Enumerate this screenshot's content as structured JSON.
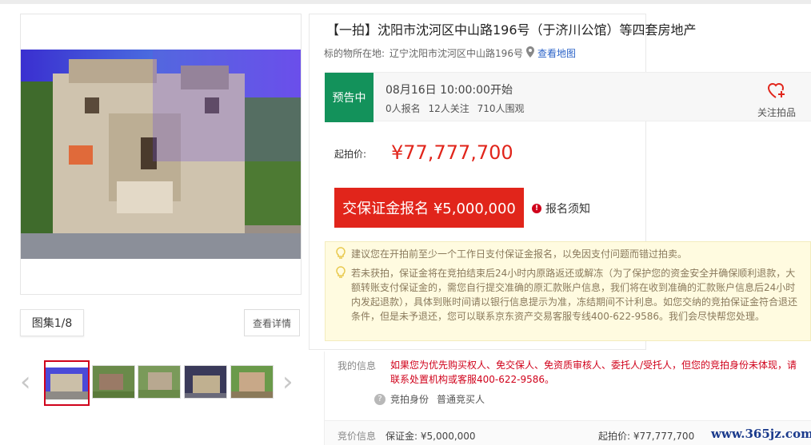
{
  "title": "【一拍】沈阳市沈河区中山路196号（于济川公馆）等四套房地产",
  "location": {
    "label": "标的物所在地:",
    "address": "辽宁沈阳市沈河区中山路196号",
    "map_link": "查看地图"
  },
  "status": {
    "badge": "预告中",
    "start_time": "08月16日 10:00:00开始",
    "signups": "0人报名",
    "followers": "12人关注",
    "viewers": "710人围观",
    "follow_label": "关注拍品"
  },
  "price": {
    "label": "起拍价:",
    "value": "¥77,777,700"
  },
  "deposit_button": "交保证金报名 ¥5,000,000",
  "notice_link": "报名须知",
  "tips": [
    "建议您在开拍前至少一个工作日支付保证金报名，以免因支付问题而错过拍卖。",
    "若未获拍，保证金将在竞拍结束后24小时内原路返还或解冻（为了保护您的资金安全并确保顺利退款，大额转账支付保证金的，需您自行提交准确的原汇款账户信息，我们将在收到准确的汇款账户信息后24小时内发起退款），具体到账时间请以银行信息提示为准，冻结期间不计利息。如您交纳的竞拍保证金符合退还条件，但是未予退还，您可以联系京东资产交易客服专线400-622-9586。我们会尽快帮您处理。"
  ],
  "my_info": {
    "label": "我的信息",
    "text": "如果您为优先购买权人、免交保人、免资质审核人、委托人/受托人，但您的竞拍身份未体现，请联系处置机构或客服400-622-9586。",
    "identity_label": "竞拍身份",
    "identity_value": "普通竞买人"
  },
  "bid_info": {
    "label": "竞价信息",
    "deposit": "保证金: ¥5,000,000",
    "start_price": "起拍价: ¥77,777,700"
  },
  "gallery": {
    "counter": "图集1/8",
    "detail_button": "查看详情",
    "prev_icon": "chevron-left-icon",
    "next_icon": "chevron-right-icon"
  },
  "watermark": "www.365jz.com",
  "colors": {
    "accent_red": "#e1251b",
    "status_green": "#13925b",
    "link_blue": "#2b63c8",
    "tip_bg": "#fffbe0"
  }
}
